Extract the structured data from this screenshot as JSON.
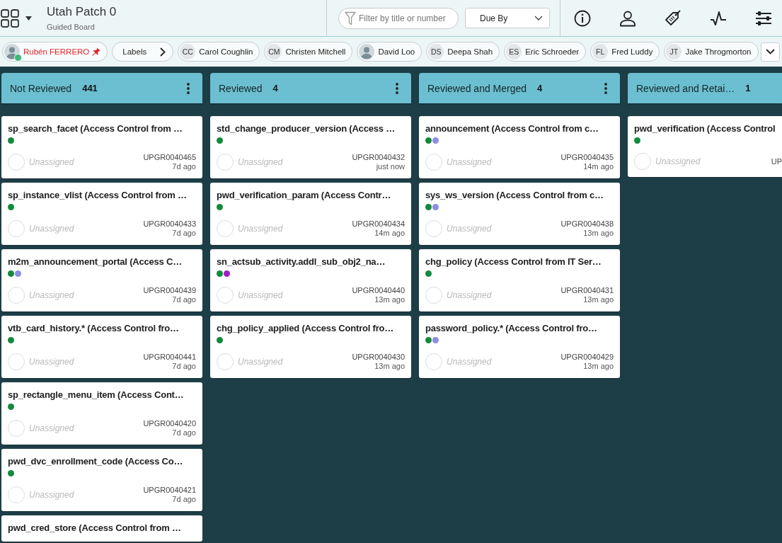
{
  "board": {
    "title": "Utah Patch 0",
    "subtitle": "Guided Board"
  },
  "toolbar": {
    "filter": {
      "placeholder": "Filter by title or number"
    },
    "sort": {
      "value": "Due By"
    }
  },
  "filters": [
    {
      "kind": "user",
      "name": "Rubén FERRERO",
      "online": true,
      "pinned": true,
      "selected": true
    },
    {
      "kind": "labels",
      "label": "Labels"
    },
    {
      "kind": "user",
      "name": "Carol Coughlin",
      "initials": "CC",
      "online": false,
      "pinned": false,
      "selected": false
    },
    {
      "kind": "user",
      "name": "Christen Mitchell",
      "initials": "CM",
      "online": false,
      "pinned": false,
      "selected": false
    },
    {
      "kind": "user",
      "name": "David Loo",
      "online": false,
      "pinned": false,
      "selected": false
    },
    {
      "kind": "user",
      "name": "Deepa Shah",
      "initials": "DS",
      "online": false,
      "pinned": false,
      "selected": false
    },
    {
      "kind": "user",
      "name": "Eric Schroeder",
      "initials": "ES",
      "online": false,
      "pinned": false,
      "selected": false
    },
    {
      "kind": "user",
      "name": "Fred Luddy",
      "initials": "FL",
      "online": false,
      "pinned": false,
      "selected": false
    },
    {
      "kind": "user",
      "name": "Jake Throgmorton",
      "initials": "JT",
      "online": false,
      "pinned": false,
      "selected": false
    }
  ],
  "columns": [
    {
      "title": "Not Reviewed",
      "count": "441",
      "clipped": false,
      "cards": [
        {
          "title": "sp_search_facet (Access Control from …",
          "tags": [
            {
              "color": "#128a3c"
            }
          ],
          "assignee": "Unassigned",
          "number": "UPGR0040465",
          "updated": "7d ago"
        },
        {
          "title": "sp_instance_vlist (Access Control from …",
          "tags": [
            {
              "color": "#128a3c"
            }
          ],
          "assignee": "Unassigned",
          "number": "UPGR0040433",
          "updated": "7d ago"
        },
        {
          "title": "m2m_announcement_portal (Access C…",
          "tags": [
            {
              "color": "#128a3c"
            },
            {
              "color": "#8c8ee3"
            }
          ],
          "assignee": "Unassigned",
          "number": "UPGR0040439",
          "updated": "7d ago"
        },
        {
          "title": "vtb_card_history.* (Access Control fro…",
          "tags": [
            {
              "color": "#128a3c"
            }
          ],
          "assignee": "Unassigned",
          "number": "UPGR0040441",
          "updated": "7d ago"
        },
        {
          "title": "sp_rectangle_menu_item (Access Cont…",
          "tags": [
            {
              "color": "#128a3c"
            }
          ],
          "assignee": "Unassigned",
          "number": "UPGR0040420",
          "updated": "7d ago"
        },
        {
          "title": "pwd_dvc_enrollment_code (Access Co…",
          "tags": [
            {
              "color": "#128a3c"
            }
          ],
          "assignee": "Unassigned",
          "number": "UPGR0040421",
          "updated": "7d ago"
        },
        {
          "title": "pwd_cred_store (Access Control from …"
        }
      ]
    },
    {
      "title": "Reviewed",
      "count": "4",
      "clipped": false,
      "cards": [
        {
          "title": "std_change_producer_version (Access …",
          "tags": [
            {
              "color": "#128a3c"
            }
          ],
          "assignee": "Unassigned",
          "number": "UPGR0040432",
          "updated": "just now"
        },
        {
          "title": "pwd_verification_param (Access Contr…",
          "tags": [
            {
              "color": "#128a3c"
            }
          ],
          "assignee": "Unassigned",
          "number": "UPGR0040434",
          "updated": "14m ago"
        },
        {
          "title": "sn_actsub_activity.addl_sub_obj2_na…",
          "tags": [
            {
              "color": "#128a3c"
            },
            {
              "color": "#a21bc8"
            }
          ],
          "assignee": "Unassigned",
          "number": "UPGR0040440",
          "updated": "13m ago"
        },
        {
          "title": "chg_policy_applied (Access Control fro…",
          "tags": [
            {
              "color": "#128a3c"
            }
          ],
          "assignee": "Unassigned",
          "number": "UPGR0040430",
          "updated": "13m ago"
        }
      ]
    },
    {
      "title": "Reviewed and Merged",
      "count": "4",
      "clipped": false,
      "cards": [
        {
          "title": "announcement (Access Control from c…",
          "tags": [
            {
              "color": "#128a3c"
            },
            {
              "color": "#8c8ee3"
            }
          ],
          "assignee": "Unassigned",
          "number": "UPGR0040435",
          "updated": "14m ago"
        },
        {
          "title": "sys_ws_version (Access Control from c…",
          "tags": [
            {
              "color": "#128a3c"
            },
            {
              "color": "#8c8ee3"
            }
          ],
          "assignee": "Unassigned",
          "number": "UPGR0040438",
          "updated": "13m ago"
        },
        {
          "title": "chg_policy (Access Control from IT Ser…",
          "tags": [
            {
              "color": "#128a3c"
            }
          ],
          "assignee": "Unassigned",
          "number": "UPGR0040431",
          "updated": "13m ago"
        },
        {
          "title": "password_policy.* (Access Control fro…",
          "tags": [
            {
              "color": "#128a3c"
            },
            {
              "color": "#8c8ee3"
            }
          ],
          "assignee": "Unassigned",
          "number": "UPGR0040429",
          "updated": "13m ago"
        }
      ]
    },
    {
      "title": "Reviewed and Retai…",
      "count": "1",
      "clipped": true,
      "cards": [
        {
          "title": "pwd_verification (Access Control",
          "tags": [
            {
              "color": "#128a3c"
            }
          ],
          "assignee": "Unassigned",
          "number": "UP"
        }
      ]
    }
  ]
}
